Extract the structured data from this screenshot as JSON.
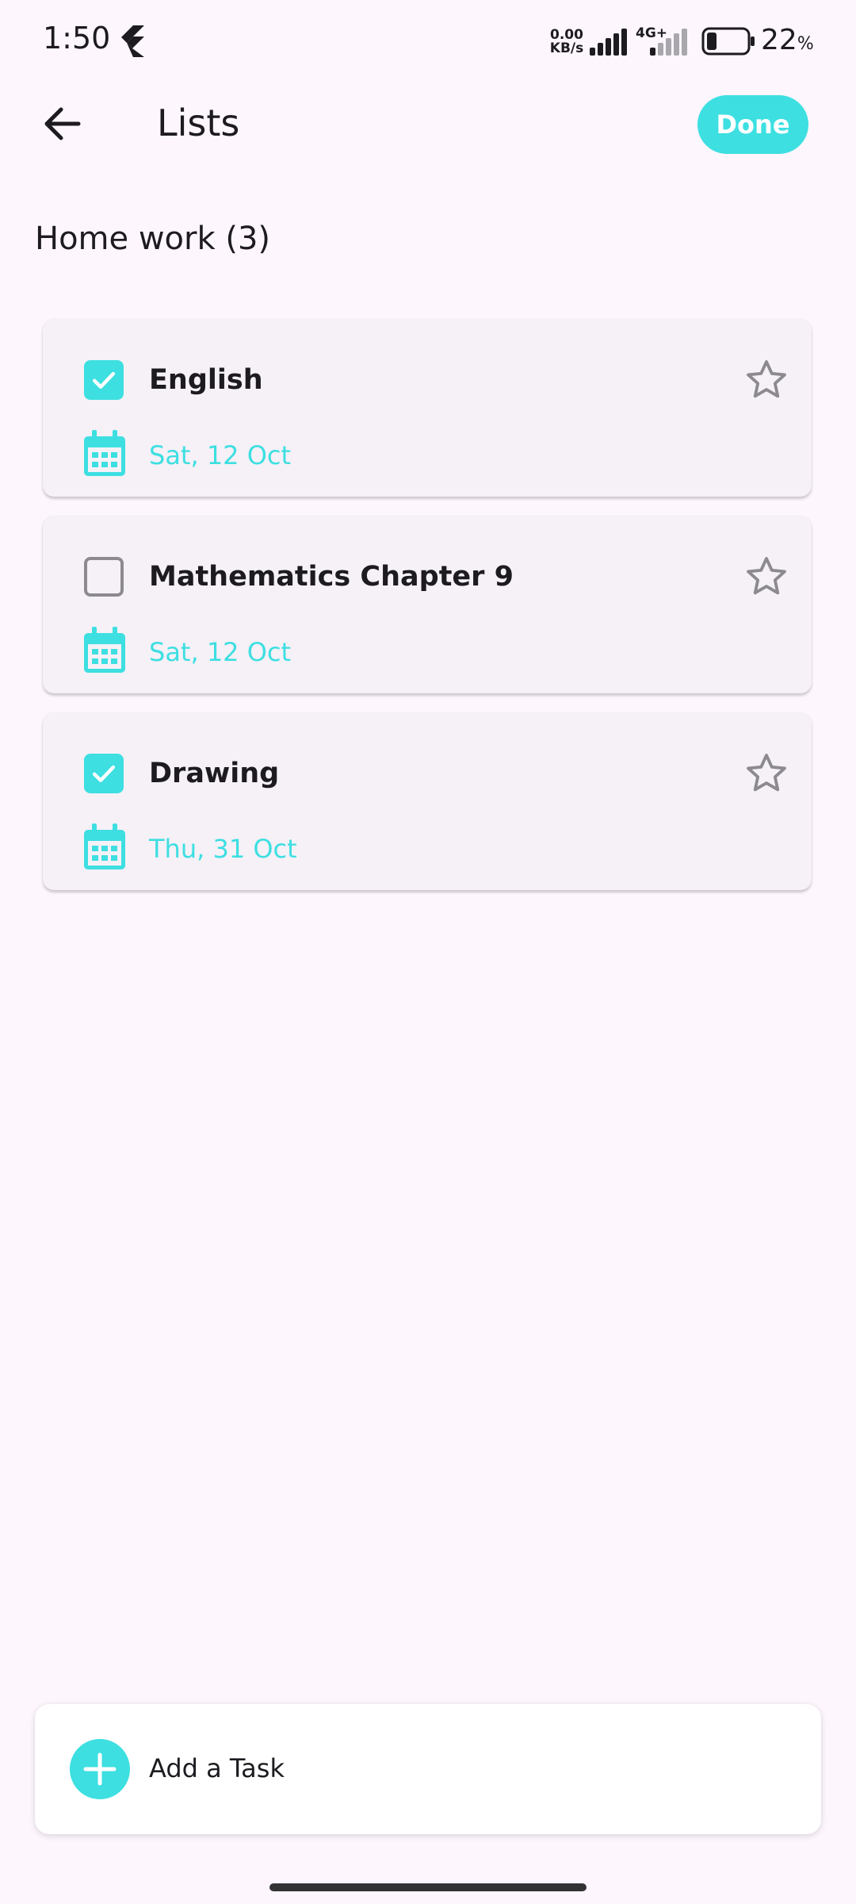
{
  "status_bar": {
    "time": "1:50",
    "net_speed_value": "0.00",
    "net_speed_unit": "KB/s",
    "network_type": "4G+",
    "battery_level": "22",
    "battery_unit": "%",
    "battery_fraction": 0.22
  },
  "app_bar": {
    "title": "Lists",
    "done_label": "Done"
  },
  "list": {
    "heading": "Home work (3)"
  },
  "tasks": [
    {
      "title": "English",
      "date": "Sat, 12 Oct",
      "completed": true,
      "starred": false
    },
    {
      "title": "Mathematics Chapter 9",
      "date": "Sat, 12 Oct",
      "completed": false,
      "starred": false
    },
    {
      "title": "Drawing",
      "date": "Thu, 31 Oct",
      "completed": true,
      "starred": false
    }
  ],
  "add_task": {
    "label": "Add a Task"
  },
  "colors": {
    "accent": "#3ddfe1",
    "background": "#fdf6fd",
    "card": "#f5f1f7",
    "text": "#1d1b20",
    "muted_icon": "#8c8a90"
  },
  "icons": {
    "back": "arrow-left-icon",
    "checkbox_checked": "check-icon",
    "star": "star-outline-icon",
    "calendar": "calendar-icon",
    "add": "plus-icon",
    "app": "flutter-icon"
  }
}
